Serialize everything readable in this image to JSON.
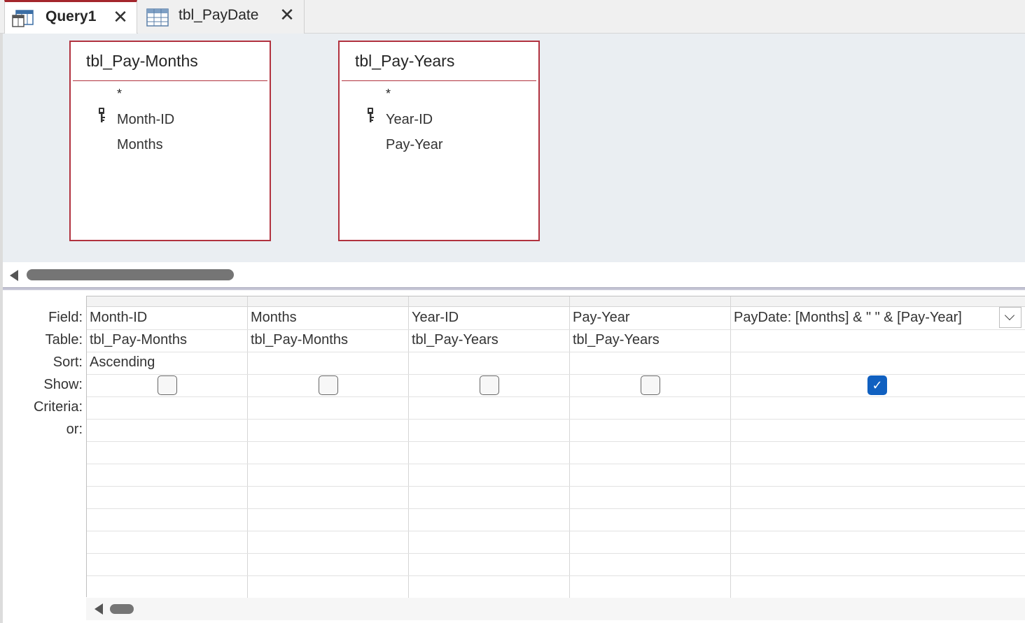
{
  "tabs": [
    {
      "label": "Query1",
      "icon": "query-icon",
      "active": true
    },
    {
      "label": "tbl_PayDate",
      "icon": "table-icon",
      "active": false
    }
  ],
  "tables": [
    {
      "title": "tbl_Pay-Months",
      "star": "*",
      "fields": [
        {
          "name": "Month-ID",
          "primary_key": true
        },
        {
          "name": "Months",
          "primary_key": false
        }
      ]
    },
    {
      "title": "tbl_Pay-Years",
      "star": "*",
      "fields": [
        {
          "name": "Year-ID",
          "primary_key": true
        },
        {
          "name": "Pay-Year",
          "primary_key": false
        }
      ]
    }
  ],
  "grid": {
    "row_labels": [
      "Field:",
      "Table:",
      "Sort:",
      "Show:",
      "Criteria:",
      "or:"
    ],
    "columns": [
      {
        "field": "Month-ID",
        "table": "tbl_Pay-Months",
        "sort": "Ascending",
        "show": false
      },
      {
        "field": "Months",
        "table": "tbl_Pay-Months",
        "sort": "",
        "show": false
      },
      {
        "field": "Year-ID",
        "table": "tbl_Pay-Years",
        "sort": "",
        "show": false
      },
      {
        "field": "Pay-Year",
        "table": "tbl_Pay-Years",
        "sort": "",
        "show": false
      },
      {
        "field": "PayDate: [Months] & \" \" & [Pay-Year]",
        "table": "",
        "sort": "",
        "show": true
      }
    ]
  },
  "colors": {
    "accent": "#a4262c",
    "table_border": "#b1323f",
    "checkbox_on": "#1060c0"
  }
}
